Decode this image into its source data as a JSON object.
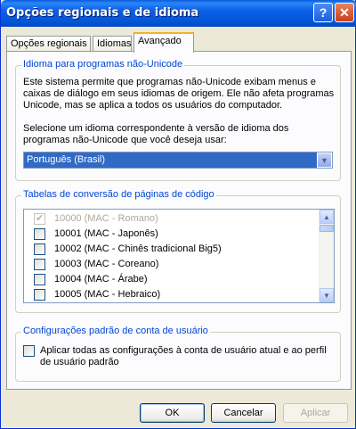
{
  "window": {
    "title": "Opções regionais e de idioma",
    "help": "?",
    "close": "✕"
  },
  "tabs": [
    {
      "label": "Opções regionais"
    },
    {
      "label": "Idiomas"
    },
    {
      "label": "Avançado"
    }
  ],
  "active_tab": "Avançado",
  "unicode_group": {
    "legend": "Idioma para programas não-Unicode",
    "description": "Este sistema permite que programas não-Unicode exibam menus e caixas de diálogo em seus idiomas de origem. Ele não afeta programas Unicode, mas se aplica a todos os usuários do computador.",
    "instruction": "Selecione um idioma correspondente à versão de idioma dos programas não-Unicode que você deseja usar:",
    "selected_language": "Português (Brasil)"
  },
  "codepage_group": {
    "legend": "Tabelas de conversão de páginas de código",
    "items": [
      {
        "label": "10000 (MAC - Romano)",
        "checked": true,
        "disabled": true
      },
      {
        "label": "10001 (MAC - Japonês)",
        "checked": false,
        "disabled": false
      },
      {
        "label": "10002 (MAC - Chinês tradicional Big5)",
        "checked": false,
        "disabled": false
      },
      {
        "label": "10003 (MAC - Coreano)",
        "checked": false,
        "disabled": false
      },
      {
        "label": "10004 (MAC - Árabe)",
        "checked": false,
        "disabled": false
      },
      {
        "label": "10005 (MAC - Hebraico)",
        "checked": false,
        "disabled": false
      }
    ]
  },
  "account_group": {
    "legend": "Configurações padrão de conta de usuário",
    "checkbox_label": "Aplicar todas as configurações à conta de usuário atual e ao perfil de usuário padrão",
    "checked": false
  },
  "buttons": {
    "ok": "OK",
    "cancel": "Cancelar",
    "apply": "Aplicar"
  },
  "colors": {
    "title_bar": "#0a5de0",
    "legend": "#0046d5",
    "selection": "#316ac5",
    "active_tab_accent": "#f4b030"
  }
}
